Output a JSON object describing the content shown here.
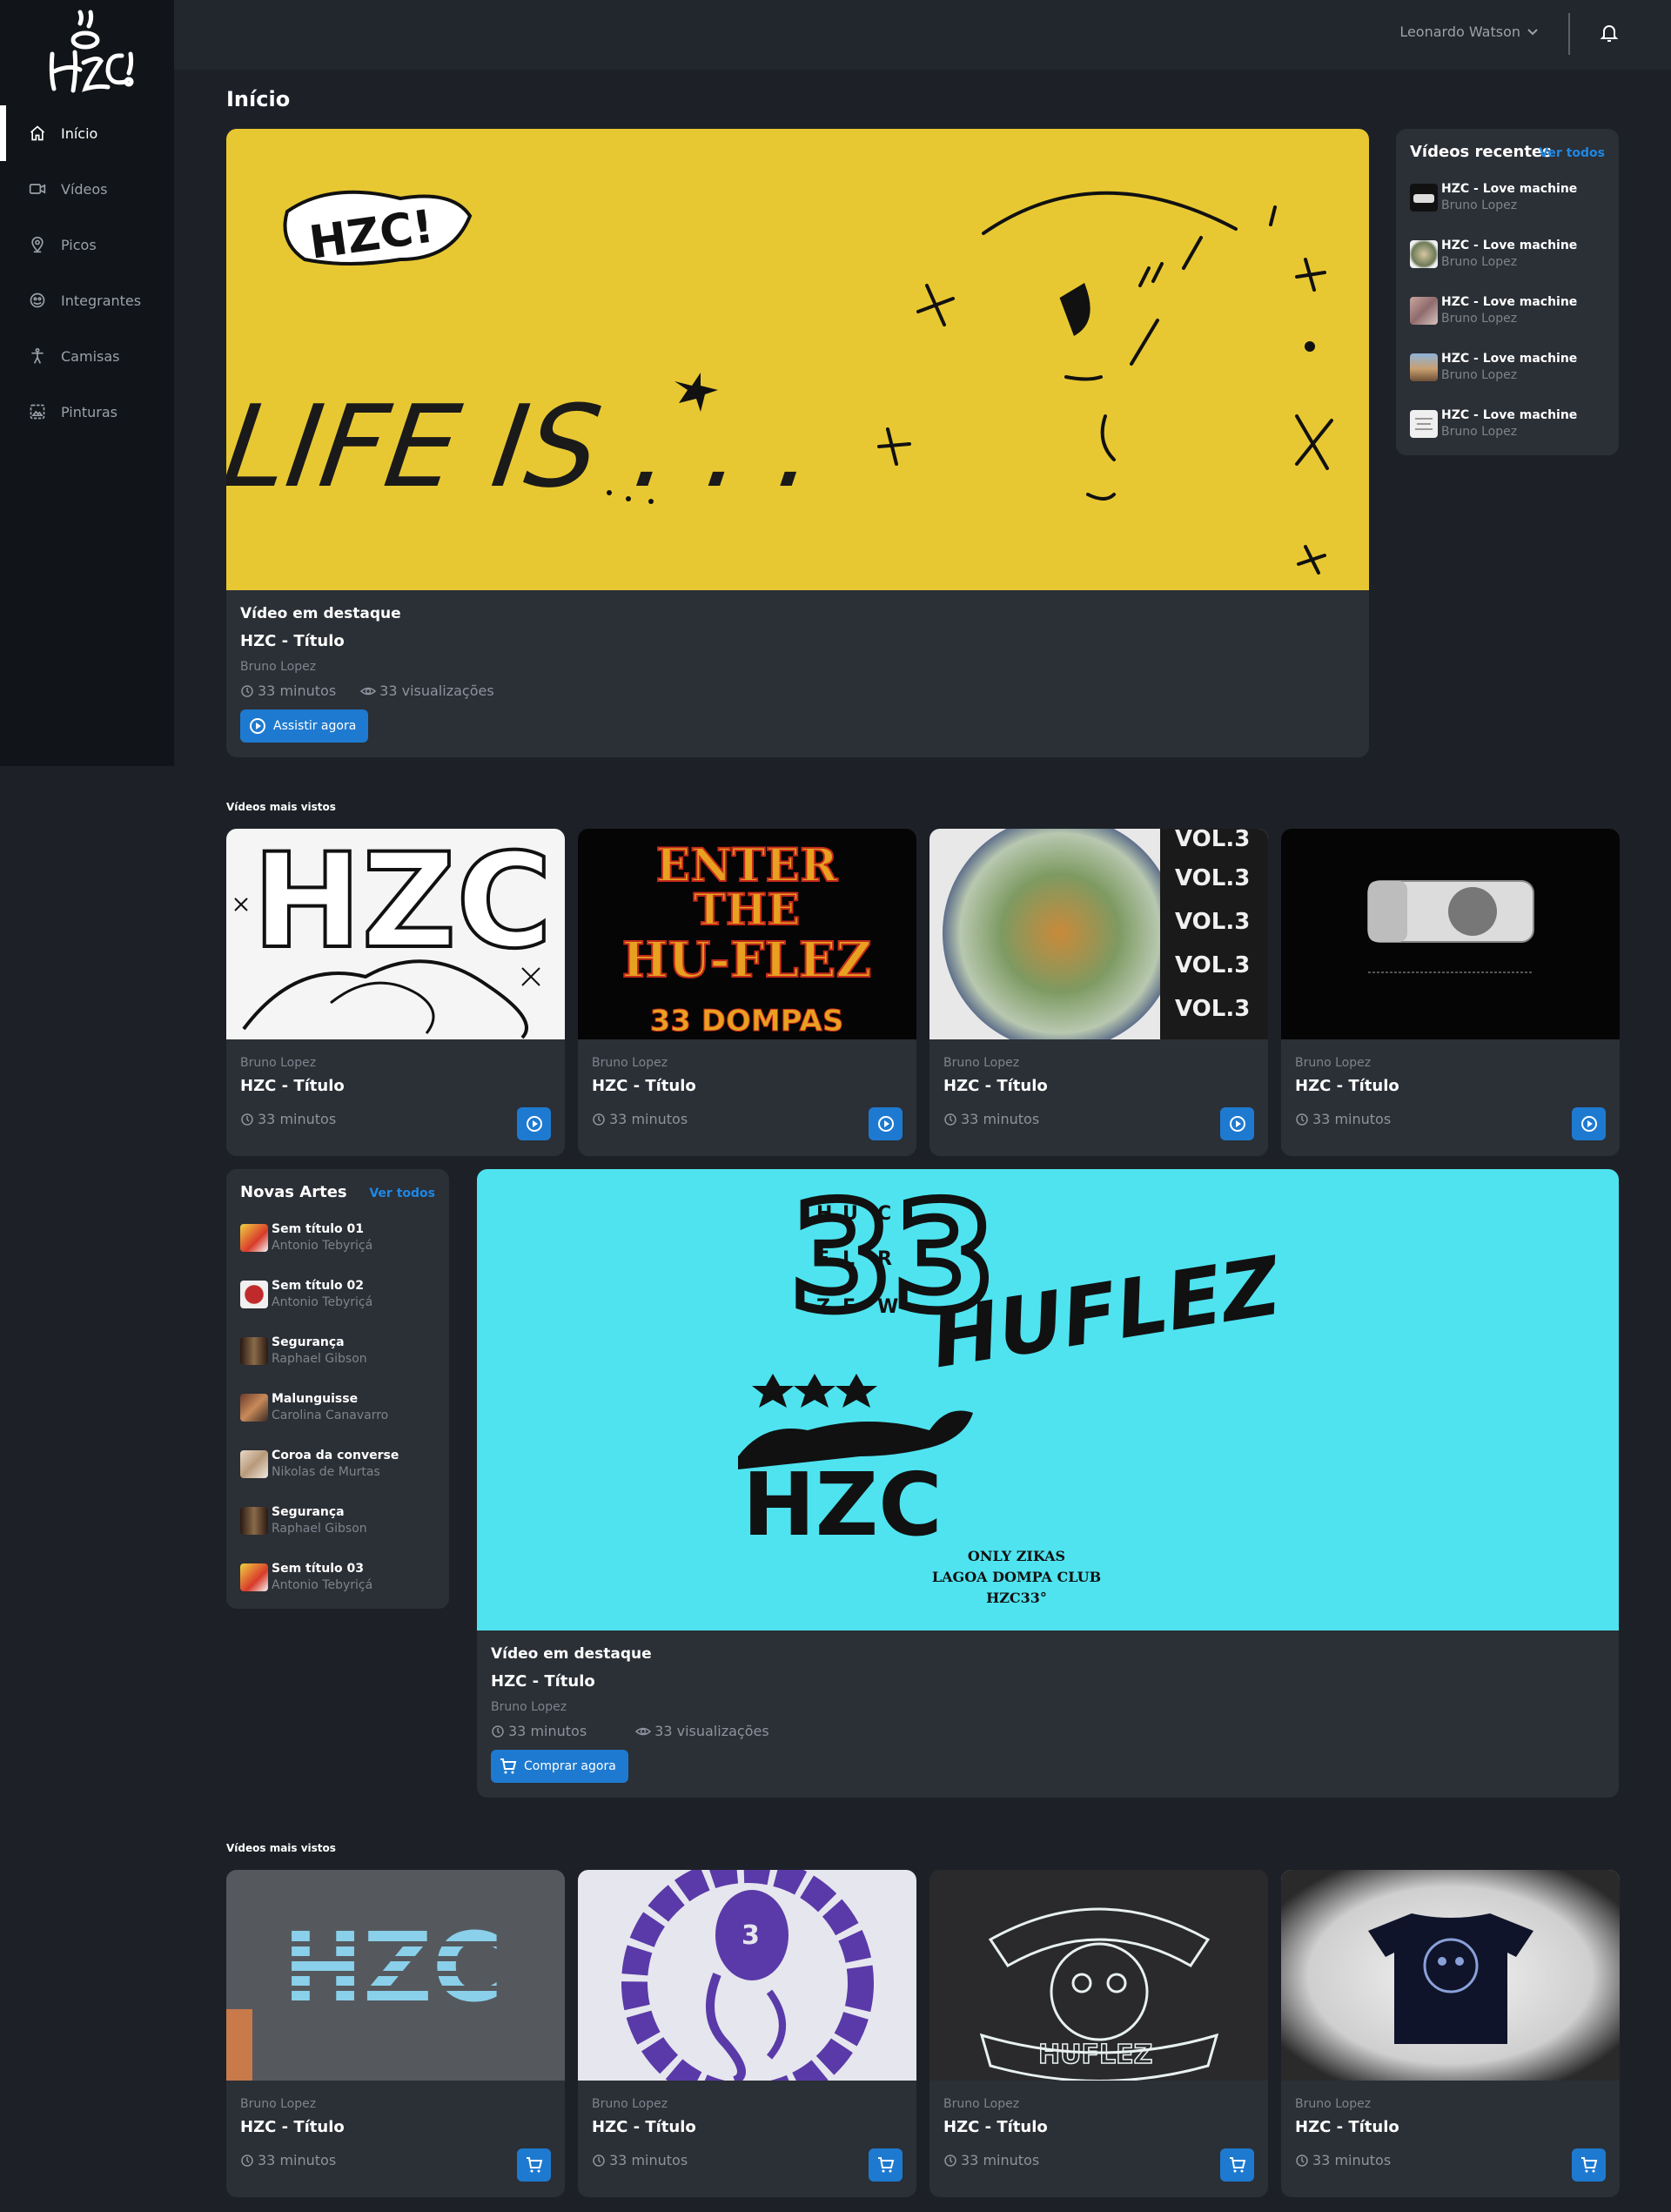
{
  "user": {
    "name": "Leonardo Watson"
  },
  "nav": [
    {
      "label": "Início",
      "icon": "home-icon",
      "active": true
    },
    {
      "label": "Vídeos",
      "icon": "video-icon"
    },
    {
      "label": "Picos",
      "icon": "location-pin-icon"
    },
    {
      "label": "Integrantes",
      "icon": "users-icon"
    },
    {
      "label": "Camisas",
      "icon": "person-icon"
    },
    {
      "label": "Pinturas",
      "icon": "image-icon"
    }
  ],
  "page_title": "Início",
  "featured1": {
    "label": "Vídeo em destaque",
    "title": "HZC - Título",
    "author": "Bruno Lopez",
    "duration": "33 minutos",
    "views": "33 visualizações",
    "button": "Assistir agora",
    "banner_text": "LIFE IS . . ."
  },
  "recent": {
    "title": "Vídeos recentes",
    "more": "Ver todos",
    "items": [
      {
        "title": "HZC - Love machine",
        "author": "Bruno Lopez"
      },
      {
        "title": "HZC - Love machine",
        "author": "Bruno Lopez"
      },
      {
        "title": "HZC - Love machine",
        "author": "Bruno Lopez"
      },
      {
        "title": "HZC - Love machine",
        "author": "Bruno Lopez"
      },
      {
        "title": "HZC - Love machine",
        "author": "Bruno Lopez"
      }
    ]
  },
  "most_viewed1": {
    "label": "Vídeos mais vistos",
    "cards": [
      {
        "author": "Bruno Lopez",
        "title": "HZC - Título",
        "duration": "33 minutos",
        "art": "HZC"
      },
      {
        "author": "Bruno Lopez",
        "title": "HZC - Título",
        "duration": "33 minutos",
        "art": "ENTER THE HU-FLEZ 33 DOMPAS"
      },
      {
        "author": "Bruno Lopez",
        "title": "HZC - Título",
        "duration": "33 minutos",
        "art": "VOL.3"
      },
      {
        "author": "Bruno Lopez",
        "title": "HZC - Título",
        "duration": "33 minutos",
        "art": ""
      }
    ]
  },
  "new_arts": {
    "title": "Novas Artes",
    "more": "Ver todos",
    "items": [
      {
        "title": "Sem título 01",
        "author": "Antonio Tebyriçá"
      },
      {
        "title": "Sem título 02",
        "author": "Antonio Tebyriçá"
      },
      {
        "title": "Segurança",
        "author": "Raphael Gibson"
      },
      {
        "title": "Malunguisse",
        "author": "Carolina Canavarro"
      },
      {
        "title": "Coroa da converse",
        "author": "Nikolas de Murtas"
      },
      {
        "title": "Segurança",
        "author": "Raphael Gibson"
      },
      {
        "title": "Sem título 03",
        "author": "Antonio Tebyriçá"
      }
    ]
  },
  "featured2": {
    "label": "Vídeo em destaque",
    "title": "HZC - Título",
    "author": "Bruno Lopez",
    "duration": "33 minutos",
    "views": "33 visualizações",
    "button": "Comprar agora",
    "art": {
      "hufle": "HUFLEZ",
      "hzc": "HZC",
      "line1": "ONLY ZIKAS",
      "line2": "LAGOA DOMPA CLUB",
      "line3": "HZC33°"
    }
  },
  "most_viewed2": {
    "label": "Vídeos mais vistos",
    "cards": [
      {
        "author": "Bruno Lopez",
        "title": "HZC - Título",
        "duration": "33 minutos",
        "art": "HZC"
      },
      {
        "author": "Bruno Lopez",
        "title": "HZC - Título",
        "duration": "33 minutos",
        "art": "3"
      },
      {
        "author": "Bruno Lopez",
        "title": "HZC - Título",
        "duration": "33 minutos",
        "art": "HUFLEZ"
      },
      {
        "author": "Bruno Lopez",
        "title": "HZC - Título",
        "duration": "33 minutos",
        "art": ""
      }
    ]
  },
  "colors": {
    "accent": "#1e7ad0",
    "link": "#1e88e5",
    "banner_yellow": "#e8c832",
    "banner_cyan": "#4ee3ef",
    "card_bg": "#2b2f36",
    "page_bg": "#1d2127"
  }
}
